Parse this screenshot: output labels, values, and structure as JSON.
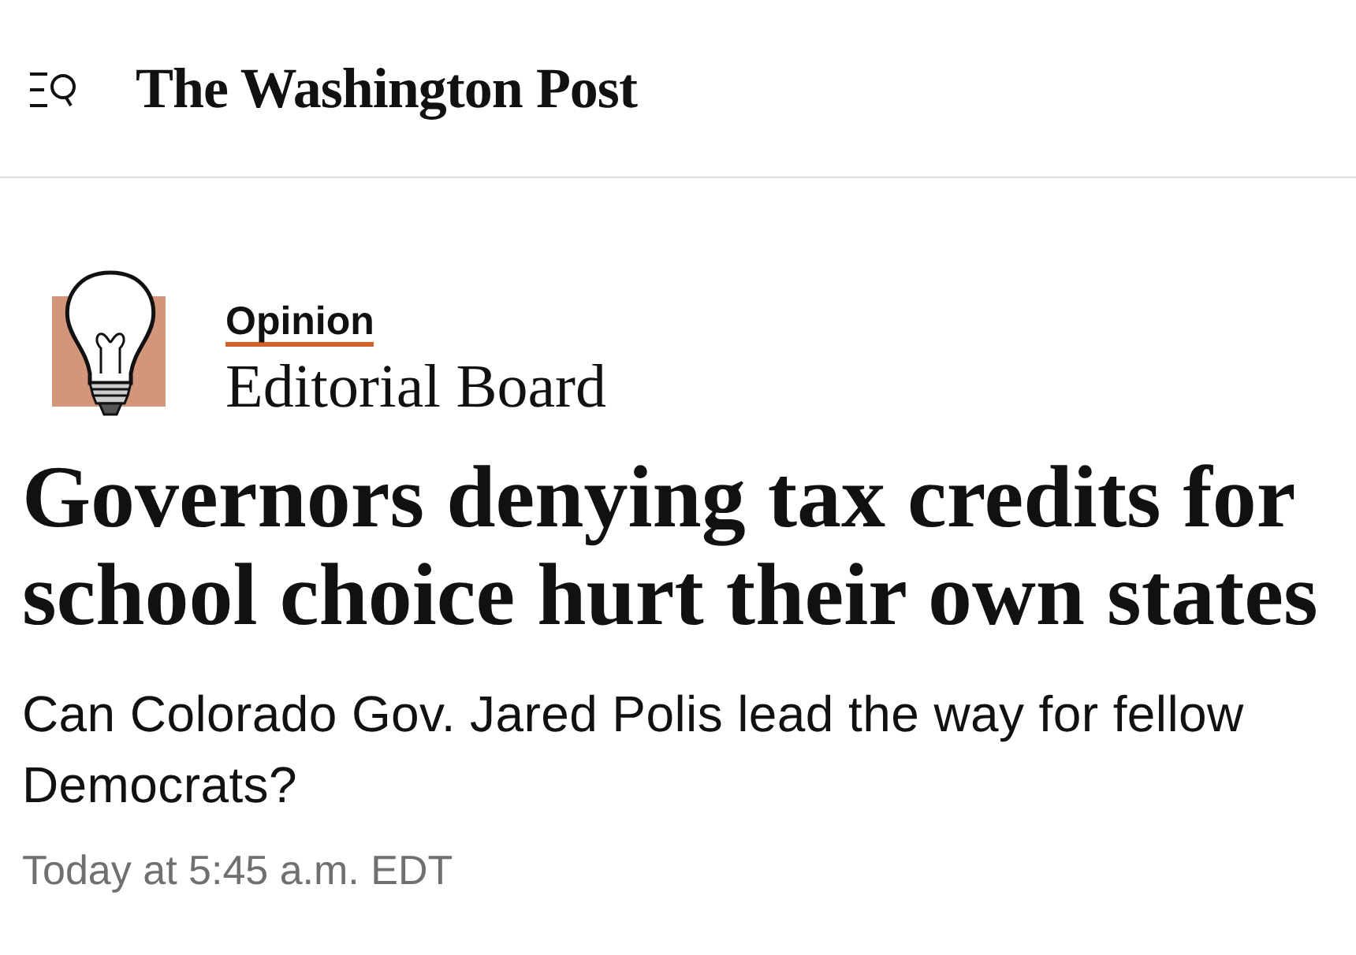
{
  "header": {
    "logo": "The Washington Post"
  },
  "byline": {
    "section": "Opinion",
    "author": "Editorial Board"
  },
  "article": {
    "headline": "Governors denying tax credits for school choice hurt their own states",
    "subheadline": "Can Colorado Gov. Jared Polis lead the way for fellow Democrats?",
    "timestamp": "Today at 5:45 a.m. EDT"
  }
}
